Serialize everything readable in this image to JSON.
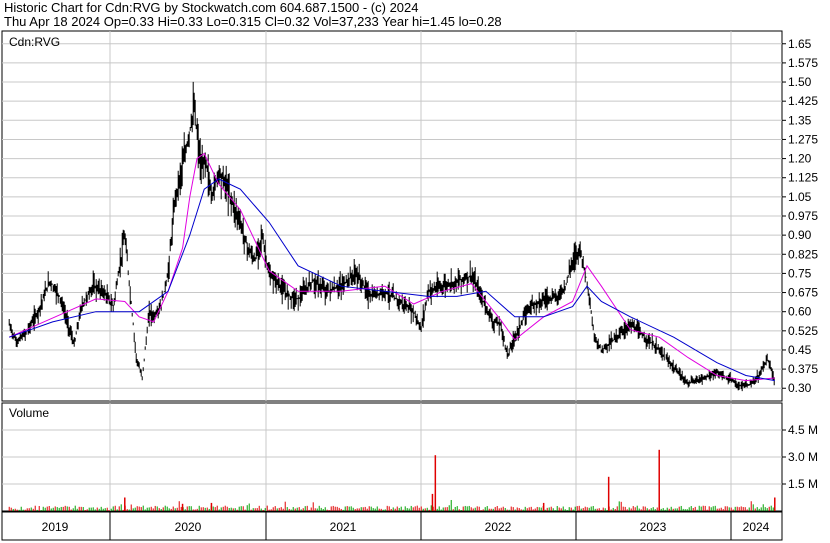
{
  "header": {
    "line1": "Historic Chart for Cdn:RVG by Stockwatch.com 604.687.1500 - (c) 2024",
    "line2": "Thu Apr 18 2024  Op=0.33  Hi=0.33  Lo=0.315  Cl=0.32  Vol=37,233  Year hi=1.45  lo=0.28"
  },
  "colors": {
    "price": "#000000",
    "ma_short": "#e000e0",
    "ma_long": "#0000cc",
    "vol_up": "#00a000",
    "vol_down": "#e00000",
    "grid": "#c8c8c8"
  },
  "chart_data": [
    {
      "type": "line",
      "title": "",
      "panel_label": "Cdn:RVG",
      "ylim": [
        0.25,
        1.7
      ],
      "yticks": [
        "1.65",
        "1.575",
        "1.50",
        "1.425",
        "1.35",
        "1.275",
        "1.20",
        "1.125",
        "1.05",
        "0.975",
        "0.90",
        "0.825",
        "0.75",
        "0.675",
        "0.60",
        "0.525",
        "0.45",
        "0.375",
        "0.30"
      ],
      "xlim": [
        2018.95,
        2024.35
      ],
      "x_labels": [
        "2019",
        "2020",
        "2021",
        "2022",
        "2023",
        "2024"
      ],
      "grid": true,
      "series": [
        {
          "x": [
            2019.0,
            2019.05,
            2019.12,
            2019.2,
            2019.28,
            2019.35,
            2019.45,
            2019.5,
            2019.58,
            2019.65,
            2019.72,
            2019.8,
            2019.88,
            2019.92,
            2019.97,
            2020.0,
            2020.05,
            2020.1,
            2020.15,
            2020.22,
            2020.28,
            2020.33,
            2020.36,
            2020.4,
            2020.45,
            2020.5,
            2020.55,
            2020.6,
            2020.65,
            2020.7,
            2020.75,
            2020.8,
            2020.85,
            2020.9,
            2020.95,
            2021.0,
            2021.1,
            2021.2,
            2021.3,
            2021.4,
            2021.5,
            2021.6,
            2021.7,
            2021.8,
            2021.85,
            2021.9,
            2022.0,
            2022.1,
            2022.2,
            2022.3,
            2022.35,
            2022.4,
            2022.45,
            2022.5,
            2022.6,
            2022.7,
            2022.8,
            2022.85,
            2022.9,
            2022.95,
            2023.0,
            2023.05,
            2023.1,
            2023.2,
            2023.3,
            2023.4,
            2023.5,
            2023.6,
            2023.7,
            2023.8,
            2023.9,
            2024.0,
            2024.05,
            2024.1,
            2024.15,
            2024.2,
            2024.25,
            2024.3
          ],
          "y": [
            0.55,
            0.48,
            0.52,
            0.6,
            0.72,
            0.66,
            0.47,
            0.62,
            0.7,
            0.68,
            0.62,
            0.9,
            0.42,
            0.34,
            0.6,
            0.58,
            0.62,
            0.75,
            1.05,
            1.22,
            1.4,
            1.15,
            1.2,
            1.05,
            1.15,
            1.1,
            1.02,
            0.95,
            0.85,
            0.8,
            0.9,
            0.74,
            0.72,
            0.68,
            0.66,
            0.65,
            0.72,
            0.68,
            0.7,
            0.75,
            0.66,
            0.68,
            0.64,
            0.6,
            0.53,
            0.68,
            0.7,
            0.72,
            0.74,
            0.62,
            0.56,
            0.55,
            0.43,
            0.5,
            0.62,
            0.65,
            0.66,
            0.7,
            0.8,
            0.85,
            0.72,
            0.5,
            0.45,
            0.5,
            0.55,
            0.5,
            0.45,
            0.38,
            0.32,
            0.34,
            0.36,
            0.33,
            0.31,
            0.31,
            0.32,
            0.36,
            0.42,
            0.32
          ]
        },
        {
          "x": [
            2019.0,
            2019.2,
            2019.4,
            2019.6,
            2019.8,
            2019.9,
            2020.0,
            2020.1,
            2020.2,
            2020.25,
            2020.3,
            2020.35,
            2020.45,
            2020.6,
            2020.8,
            2021.0,
            2021.3,
            2021.6,
            2021.8,
            2022.0,
            2022.2,
            2022.4,
            2022.5,
            2022.7,
            2022.9,
            2023.0,
            2023.1,
            2023.3,
            2023.5,
            2023.7,
            2023.9,
            2024.1,
            2024.3
          ],
          "y": [
            0.5,
            0.55,
            0.6,
            0.65,
            0.64,
            0.58,
            0.56,
            0.68,
            0.85,
            1.05,
            1.2,
            1.22,
            1.1,
            1.0,
            0.76,
            0.68,
            0.68,
            0.7,
            0.63,
            0.68,
            0.71,
            0.57,
            0.49,
            0.58,
            0.64,
            0.78,
            0.7,
            0.53,
            0.5,
            0.42,
            0.35,
            0.33,
            0.34
          ]
        },
        {
          "x": [
            2019.0,
            2019.3,
            2019.6,
            2019.9,
            2020.1,
            2020.25,
            2020.35,
            2020.45,
            2020.6,
            2020.8,
            2021.0,
            2021.3,
            2021.6,
            2021.9,
            2022.1,
            2022.3,
            2022.5,
            2022.7,
            2022.9,
            2023.0,
            2023.1,
            2023.3,
            2023.6,
            2023.9,
            2024.1,
            2024.3
          ],
          "y": [
            0.5,
            0.56,
            0.6,
            0.6,
            0.68,
            0.9,
            1.08,
            1.12,
            1.08,
            0.95,
            0.78,
            0.7,
            0.68,
            0.66,
            0.66,
            0.68,
            0.58,
            0.58,
            0.62,
            0.7,
            0.64,
            0.58,
            0.5,
            0.4,
            0.35,
            0.33
          ]
        }
      ]
    },
    {
      "type": "bar",
      "title": "",
      "panel_label": "Volume",
      "ylim": [
        0,
        6.0
      ],
      "yticks": [
        "4.5 M",
        "3.0 M",
        "1.5 M"
      ],
      "x_labels": [
        "2019",
        "2020",
        "2021",
        "2022",
        "2023",
        "2024"
      ],
      "spikes": [
        {
          "x": 2019.8,
          "value": 0.75
        },
        {
          "x": 2020.4,
          "value": 0.45
        },
        {
          "x": 2020.2,
          "value": 0.4
        },
        {
          "x": 2021.95,
          "value": 3.1
        },
        {
          "x": 2021.93,
          "value": 0.95
        },
        {
          "x": 2022.7,
          "value": 0.45
        },
        {
          "x": 2023.15,
          "value": 1.9
        },
        {
          "x": 2023.5,
          "value": 3.4
        },
        {
          "x": 2024.3,
          "value": 0.75
        }
      ]
    }
  ]
}
